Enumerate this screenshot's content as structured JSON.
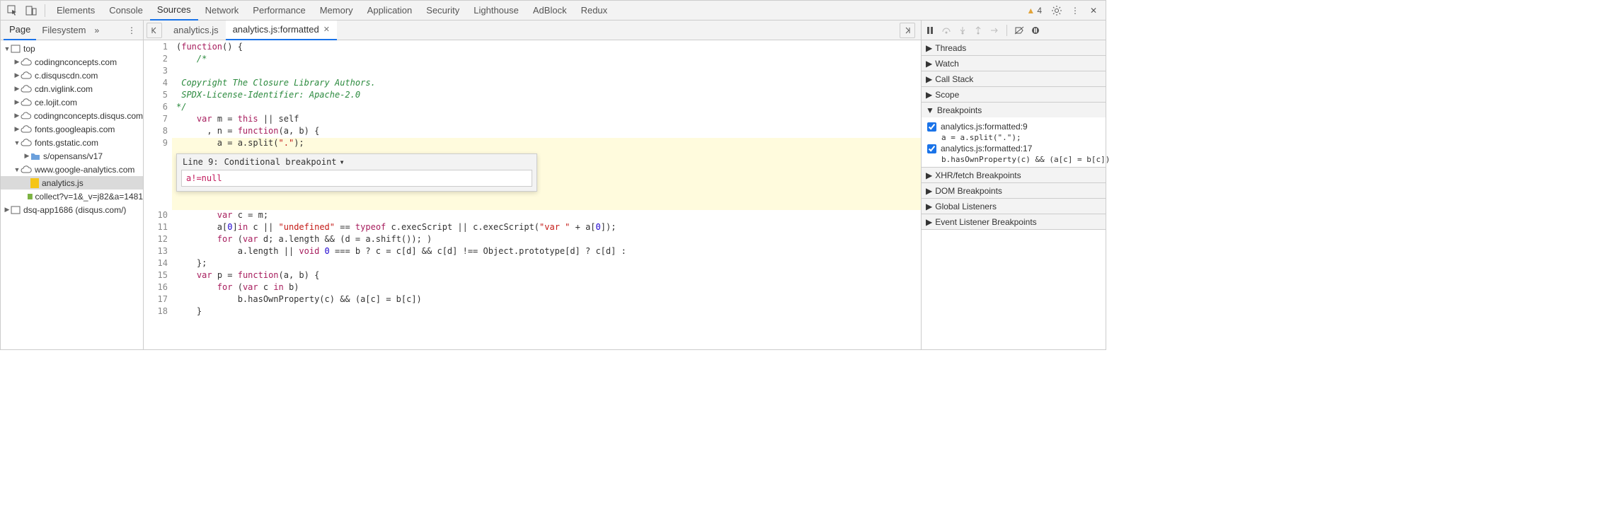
{
  "toolbar": {
    "tabs": [
      "Elements",
      "Console",
      "Sources",
      "Network",
      "Performance",
      "Memory",
      "Application",
      "Security",
      "Lighthouse",
      "AdBlock",
      "Redux"
    ],
    "active_tab": 2,
    "warning_count": "4"
  },
  "left": {
    "tabs": [
      "Page",
      "Filesystem"
    ],
    "active_tab": 0,
    "overflow": "»",
    "tree": [
      {
        "depth": 0,
        "expand": "down",
        "icon": "frame",
        "label": "top"
      },
      {
        "depth": 1,
        "expand": "right",
        "icon": "cloud",
        "label": "codingnconcepts.com"
      },
      {
        "depth": 1,
        "expand": "right",
        "icon": "cloud",
        "label": "c.disquscdn.com"
      },
      {
        "depth": 1,
        "expand": "right",
        "icon": "cloud",
        "label": "cdn.viglink.com"
      },
      {
        "depth": 1,
        "expand": "right",
        "icon": "cloud",
        "label": "ce.lojit.com"
      },
      {
        "depth": 1,
        "expand": "right",
        "icon": "cloud",
        "label": "codingnconcepts.disqus.com"
      },
      {
        "depth": 1,
        "expand": "right",
        "icon": "cloud",
        "label": "fonts.googleapis.com"
      },
      {
        "depth": 1,
        "expand": "down",
        "icon": "cloud",
        "label": "fonts.gstatic.com"
      },
      {
        "depth": 2,
        "expand": "right",
        "icon": "folder",
        "label": "s/opensans/v17"
      },
      {
        "depth": 1,
        "expand": "down",
        "icon": "cloud",
        "label": "www.google-analytics.com"
      },
      {
        "depth": 2,
        "expand": "none",
        "icon": "file-js",
        "label": "analytics.js",
        "selected": true
      },
      {
        "depth": 2,
        "expand": "none",
        "icon": "file-green",
        "label": "collect?v=1&_v=j82&a=1481"
      },
      {
        "depth": 0,
        "expand": "right",
        "icon": "frame",
        "label": "dsq-app1686 (disqus.com/)"
      }
    ]
  },
  "center": {
    "file_tabs": [
      {
        "label": "analytics.js",
        "active": false,
        "closeable": false
      },
      {
        "label": "analytics.js:formatted",
        "active": true,
        "closeable": true
      }
    ],
    "lines": [
      {
        "n": 1,
        "bp": false,
        "hl": false,
        "html": "(<span class='kw'>function</span>() {"
      },
      {
        "n": 2,
        "bp": false,
        "hl": false,
        "html": "    <span class='com'>/*</span>"
      },
      {
        "n": 3,
        "bp": false,
        "hl": false,
        "html": ""
      },
      {
        "n": 4,
        "bp": false,
        "hl": false,
        "html": " <span class='com'>Copyright The Closure Library Authors.</span>"
      },
      {
        "n": 5,
        "bp": false,
        "hl": false,
        "html": " <span class='com'>SPDX-License-Identifier: Apache-2.0</span>"
      },
      {
        "n": 6,
        "bp": false,
        "hl": false,
        "html": "<span class='com'>*/</span>"
      },
      {
        "n": 7,
        "bp": false,
        "hl": false,
        "html": "    <span class='kw'>var</span> m = <span class='kw'>this</span> || self"
      },
      {
        "n": 8,
        "bp": false,
        "hl": false,
        "html": "      , n = <span class='kw'>function</span>(a, b) {"
      },
      {
        "n": 9,
        "bp": true,
        "hl": true,
        "html": "        a = a.split(<span class='str'>\".\"</span>);"
      },
      {
        "n": 10,
        "bp": false,
        "hl": false,
        "html": "        <span class='kw'>var</span> c = m;"
      },
      {
        "n": 11,
        "bp": false,
        "hl": false,
        "html": "        a[<span class='lit'>0</span>]<span class='kw'>in</span> c || <span class='str'>\"undefined\"</span> == <span class='kw'>typeof</span> c.execScript || c.execScript(<span class='str'>\"var \"</span> + a[<span class='lit'>0</span>]);"
      },
      {
        "n": 12,
        "bp": false,
        "hl": false,
        "html": "        <span class='kw'>for</span> (<span class='kw'>var</span> d; a.length && (d = a.shift()); )"
      },
      {
        "n": 13,
        "bp": false,
        "hl": false,
        "html": "            a.length || <span class='kw'>void</span> <span class='lit'>0</span> === b ? c = c[d] && c[d] !== Object.prototype[d] ? c[d] :"
      },
      {
        "n": 14,
        "bp": false,
        "hl": false,
        "html": "    };"
      },
      {
        "n": 15,
        "bp": false,
        "hl": false,
        "html": "    <span class='kw'>var</span> p = <span class='kw'>function</span>(a, b) {"
      },
      {
        "n": 16,
        "bp": false,
        "hl": false,
        "html": "        <span class='kw'>for</span> (<span class='kw'>var</span> c <span class='kw'>in</span> b)"
      },
      {
        "n": 17,
        "bp": true,
        "hl": false,
        "html": "            b.hasOwnProperty(c) && (a[c] = b[c])"
      },
      {
        "n": 18,
        "bp": false,
        "hl": false,
        "html": "    }"
      }
    ],
    "cond": {
      "line_label": "Line 9:",
      "type_label": "Conditional breakpoint",
      "value": "a!=null"
    }
  },
  "right": {
    "sections": [
      {
        "title": "Threads",
        "open": false
      },
      {
        "title": "Watch",
        "open": false
      },
      {
        "title": "Call Stack",
        "open": false
      },
      {
        "title": "Scope",
        "open": false
      },
      {
        "title": "Breakpoints",
        "open": true
      },
      {
        "title": "XHR/fetch Breakpoints",
        "open": false
      },
      {
        "title": "DOM Breakpoints",
        "open": false
      },
      {
        "title": "Global Listeners",
        "open": false
      },
      {
        "title": "Event Listener Breakpoints",
        "open": false
      }
    ],
    "breakpoints": [
      {
        "checked": true,
        "title": "analytics.js:formatted:9",
        "code": "a = a.split(\".\");"
      },
      {
        "checked": true,
        "title": "analytics.js:formatted:17",
        "code": "b.hasOwnProperty(c) && (a[c] = b[c])"
      }
    ]
  }
}
